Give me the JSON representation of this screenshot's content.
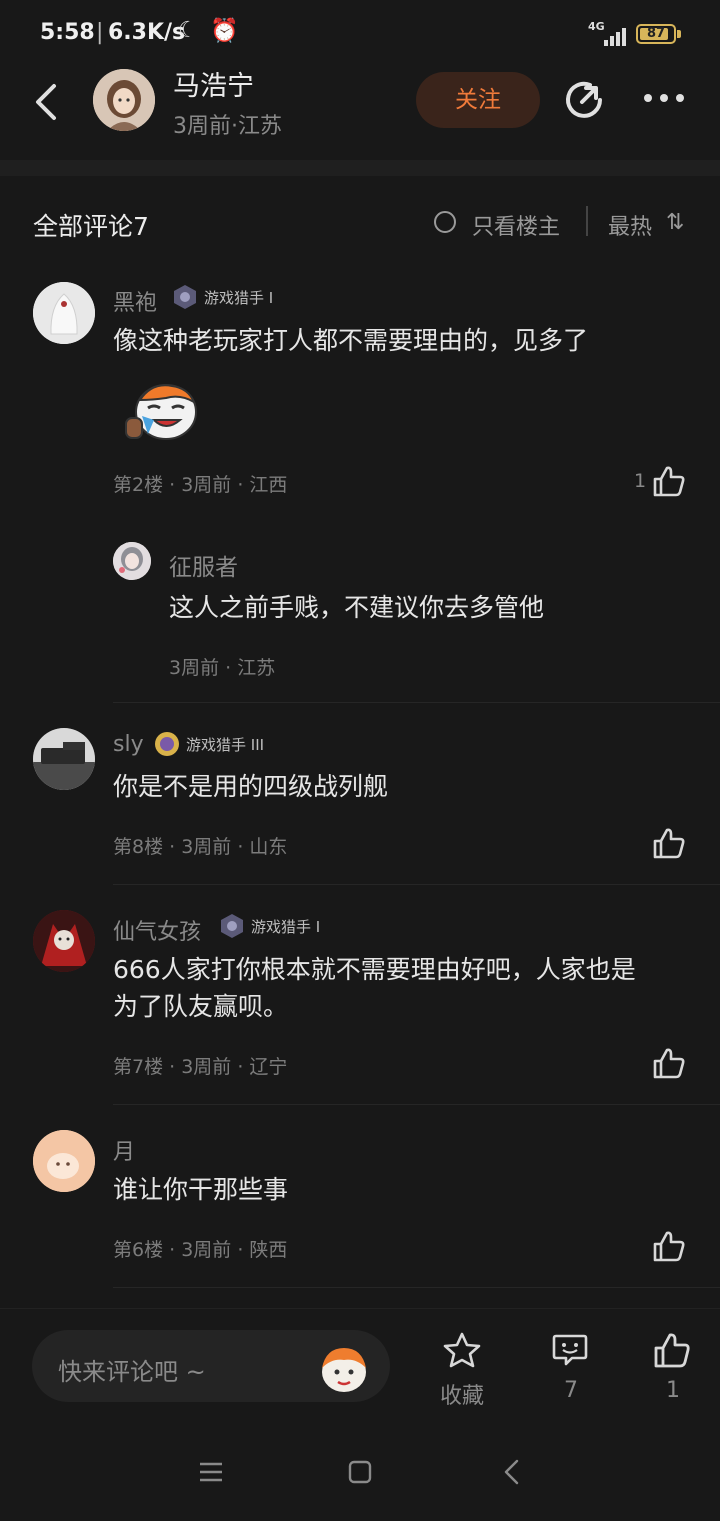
{
  "status_bar": {
    "time": "5:58",
    "separator": "|",
    "net_speed": "6.3K/s",
    "network": "4G",
    "battery": "87"
  },
  "header": {
    "author_name": "马浩宁",
    "author_meta": "3周前·江苏",
    "follow_label": "关注"
  },
  "comments_header": {
    "title": "全部评论7",
    "op_only": "只看楼主",
    "sort_label": "最热",
    "sort_icon": "⇅"
  },
  "comments": [
    {
      "name": "黑袍",
      "badge": "游戏猎手 I",
      "text": "像这种老玩家打人都不需要理由的，见多了",
      "meta": "第2楼 · 3周前 · 江西",
      "likes": "1"
    },
    {
      "name": "sly",
      "badge": "游戏猎手 III",
      "text": "你是不是用的四级战列舰",
      "meta": "第8楼 · 3周前 · 山东"
    },
    {
      "name": "仙气女孩",
      "badge": "游戏猎手 I",
      "text_line1": "666人家打你根本就不需要理由好吧，人家也是",
      "text_line2": "为了队友赢呗。",
      "meta": "第7楼 · 3周前 · 辽宁"
    },
    {
      "name": "月",
      "text": "谁让你干那些事",
      "meta": "第6楼 · 3周前 · 陕西"
    }
  ],
  "reply": {
    "name": "征服者",
    "text": "这人之前手贱，不建议你去多管他",
    "meta": "3周前 · 江苏"
  },
  "bottom_bar": {
    "input_placeholder": "快来评论吧 ~",
    "favorite_label": "收藏",
    "comment_count": "7",
    "like_count": "1"
  },
  "colors": {
    "background": "#181818",
    "accent_orange": "#f07a3a",
    "follow_bg": "#3a241b",
    "battery": "#d7b55a"
  },
  "icons": [
    "back-arrow-icon",
    "share-icon",
    "more-icon",
    "radio-icon",
    "sort-icon",
    "thumbs-up-icon",
    "star-icon",
    "comment-icon",
    "menu-icon",
    "home-icon",
    "nav-back-icon"
  ]
}
